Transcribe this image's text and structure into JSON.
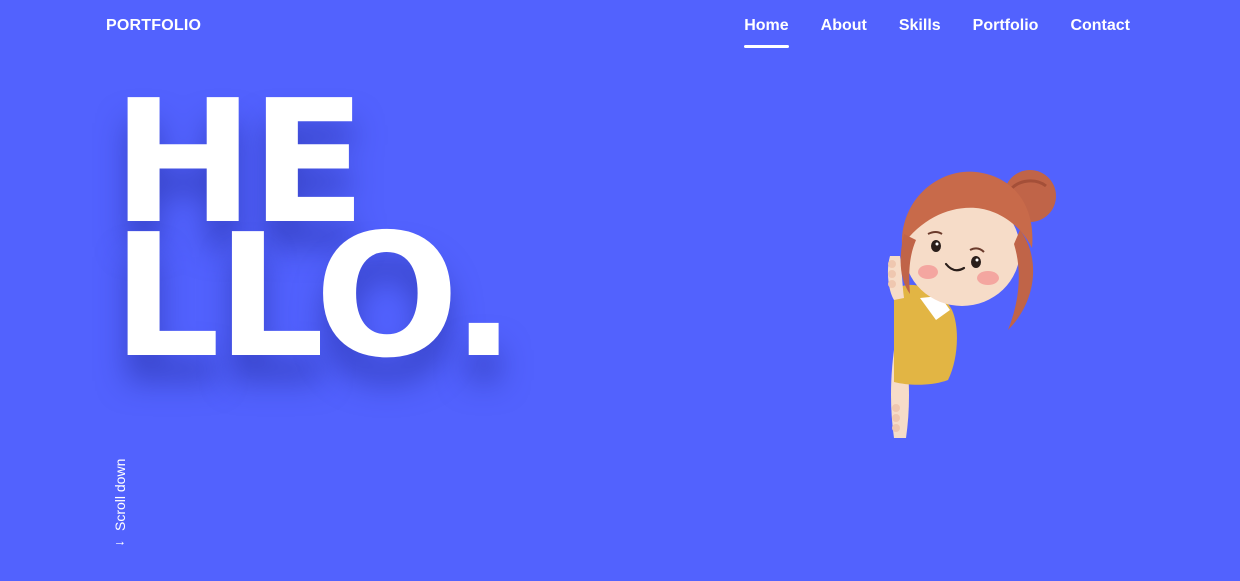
{
  "header": {
    "brand": "PORTFOLIO",
    "nav": [
      {
        "label": "Home",
        "active": true
      },
      {
        "label": "About",
        "active": false
      },
      {
        "label": "Skills",
        "active": false
      },
      {
        "label": "Portfolio",
        "active": false
      },
      {
        "label": "Contact",
        "active": false
      }
    ]
  },
  "hero": {
    "line1": "HE",
    "line2": "LLO."
  },
  "scroll": {
    "label": "Scroll down",
    "icon": "arrow-down-icon"
  },
  "illustration": {
    "icon": "girl-peeking-icon"
  },
  "colors": {
    "background": "#5262fe",
    "text": "#ffffff",
    "hair": "#c86a4a",
    "shirt": "#e2b544",
    "skin": "#f6dcc8"
  }
}
